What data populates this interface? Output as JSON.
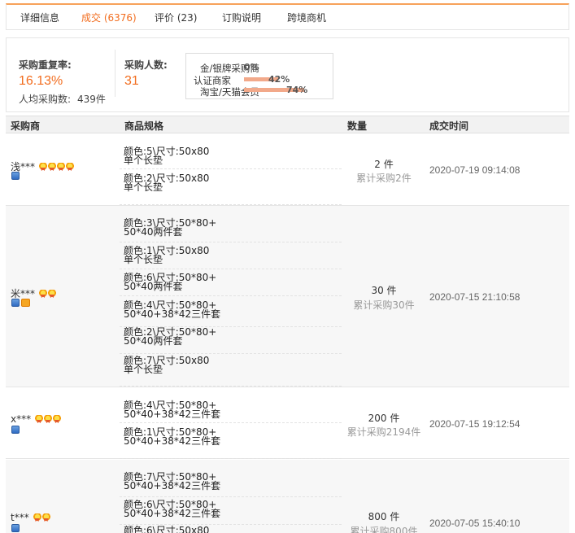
{
  "tabs": [
    {
      "label": "详细信息"
    },
    {
      "label": "成交 (6376)",
      "active": true
    },
    {
      "label": "评价 (23)"
    },
    {
      "label": "订购说明"
    },
    {
      "label": "跨境商机"
    }
  ],
  "summary": {
    "repeat_rate_label": "采购重复率:",
    "repeat_rate_value": "16.13%",
    "avg_label": "人均采购数:",
    "avg_value": "439件",
    "buyers_label": "采购人数:",
    "buyers_value": "31",
    "membership": [
      {
        "label": "金/银牌采购商",
        "value": "0%",
        "fraction": 0.0
      },
      {
        "label": "认证商家",
        "value": "42%",
        "fraction": 0.42
      },
      {
        "label": "淘宝/天猫会员",
        "value": "74%",
        "fraction": 0.74
      }
    ]
  },
  "table": {
    "headers": [
      "采购商",
      "商品规格",
      "数量",
      "成交时间"
    ],
    "rows": [
      {
        "buyer": "浅***",
        "medals": 4,
        "taobao": false,
        "specs": [
          "颜色:5\\尺寸:50x80\n单个长垫",
          "颜色:2\\尺寸:50x80\n单个长垫"
        ],
        "quantity": "2 件",
        "cumulative": "累计采购2件",
        "time": "2020-07-19 09:14:08"
      },
      {
        "buyer": "米***",
        "medals": 2,
        "taobao": true,
        "specs": [
          "颜色:3\\尺寸:50*80+\n50*40两件套",
          "颜色:1\\尺寸:50x80\n单个长垫",
          "颜色:6\\尺寸:50*80+\n50*40两件套",
          "颜色:4\\尺寸:50*80+\n50*40+38*42三件套",
          "颜色:2\\尺寸:50*80+\n50*40两件套",
          "颜色:7\\尺寸:50x80\n单个长垫"
        ],
        "quantity": "30 件",
        "cumulative": "累计采购30件",
        "time": "2020-07-15 21:10:58"
      },
      {
        "buyer": "x***",
        "medals": 3,
        "taobao": false,
        "specs": [
          "颜色:4\\尺寸:50*80+\n50*40+38*42三件套",
          "颜色:1\\尺寸:50*80+\n50*40+38*42三件套"
        ],
        "quantity": "200 件",
        "cumulative": "累计采购2194件",
        "time": "2020-07-15 19:12:54"
      },
      {
        "buyer": "t***",
        "medals": 2,
        "taobao": false,
        "specs": [
          "颜色:7\\尺寸:50*80+\n50*40+38*42三件套",
          "颜色:6\\尺寸:50*80+\n50*40+38*42三件套",
          "颜色:6\\尺寸:50x80"
        ],
        "quantity": "800 件",
        "cumulative": "累计采购800件",
        "time": "2020-07-05 15:40:10"
      }
    ]
  },
  "colors": {
    "accent": "#f26d1f",
    "tab_border": "#f7a25a",
    "bar": "#f2a98a"
  }
}
